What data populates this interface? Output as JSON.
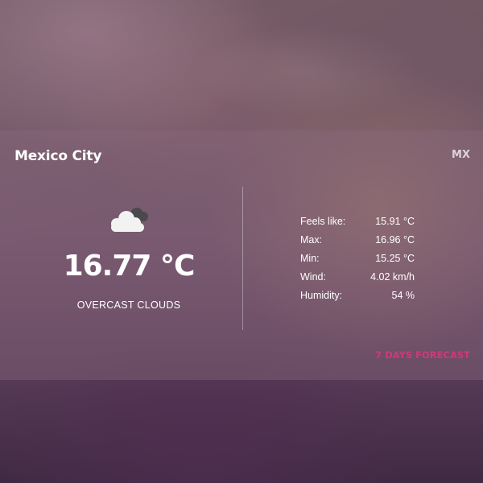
{
  "location": {
    "city": "Mexico City",
    "country_code": "MX"
  },
  "current": {
    "icon": "overcast-clouds-icon",
    "temperature": "16.77 °C",
    "condition": "OVERCAST CLOUDS"
  },
  "details": [
    {
      "label": "Feels like:",
      "value": "15.91 °C"
    },
    {
      "label": "Max:",
      "value": "16.96 °C"
    },
    {
      "label": "Min:",
      "value": "15.25 °C"
    },
    {
      "label": "Wind:",
      "value": "4.02 km/h"
    },
    {
      "label": "Humidity:",
      "value": "54 %"
    }
  ],
  "forecast_link": {
    "label": "7 DAYS FORECAST",
    "color": "#cc3a7c"
  },
  "colors": {
    "panel": "#87697d",
    "text": "#ffffff"
  }
}
